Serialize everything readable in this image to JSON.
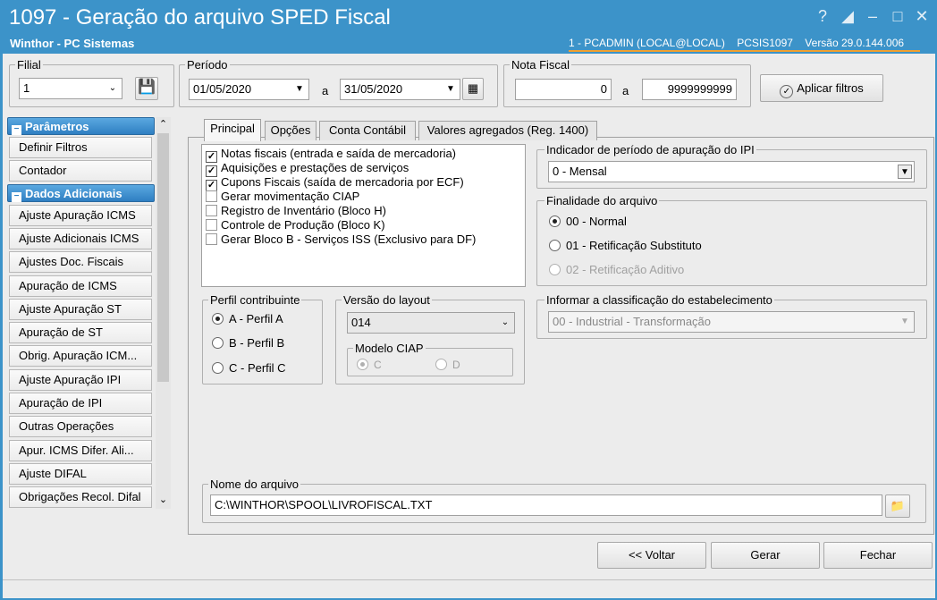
{
  "window": {
    "title": "1097 - Geração do arquivo SPED Fiscal",
    "company": "Winthor - PC Sistemas",
    "user_info": "1 - PCADMIN (LOCAL@LOCAL)",
    "routine": "PCSIS1097",
    "version": "Versão 29.0.144.006"
  },
  "filters": {
    "filial_label": "Filial",
    "filial_value": "1",
    "periodo_label": "Período",
    "periodo_start": "01/05/2020",
    "periodo_sep": "a",
    "periodo_end": "31/05/2020",
    "nota_label": "Nota Fiscal",
    "nota_start": "0",
    "nota_sep": "a",
    "nota_end": "9999999999",
    "apply_label": "Aplicar filtros"
  },
  "sidebar": {
    "section1": "Parâmetros",
    "items1": [
      "Definir Filtros",
      "Contador"
    ],
    "section2": "Dados Adicionais",
    "items2": [
      "Ajuste Apuração ICMS",
      "Ajuste Adicionais ICMS",
      "Ajustes Doc. Fiscais",
      "Apuração de ICMS",
      "Ajuste Apuração ST",
      "Apuração de ST",
      "Obrig. Apuração ICM...",
      "Ajuste Apuração IPI",
      "Apuração de IPI",
      "Outras Operações",
      "Apur. ICMS Difer. Ali...",
      "Ajuste DIFAL",
      "Obrigações Recol. Difal"
    ]
  },
  "tabs": [
    "Principal",
    "Opções",
    "Conta Contábil",
    "Valores agregados (Reg. 1400)"
  ],
  "checklist": [
    {
      "label": "Notas fiscais (entrada e saída de mercadoria)",
      "checked": true
    },
    {
      "label": "Aquisições e prestações de serviços",
      "checked": true
    },
    {
      "label": "Cupons Fiscais (saída de mercadoria por ECF)",
      "checked": true
    },
    {
      "label": "Gerar movimentação CIAP",
      "checked": false
    },
    {
      "label": "Registro de Inventário (Bloco H)",
      "checked": false
    },
    {
      "label": "Controle de Produção (Bloco K)",
      "checked": false
    },
    {
      "label": "Gerar Bloco B - Serviços ISS (Exclusivo para DF)",
      "checked": false
    }
  ],
  "ipi": {
    "label": "Indicador de período de apuração do IPI",
    "value": "0 - Mensal"
  },
  "finalidade": {
    "label": "Finalidade do arquivo",
    "options": [
      "00 - Normal",
      "01 - Retificação Substituto",
      "02 - Retificação Aditivo"
    ],
    "selected": 0
  },
  "perfil": {
    "label": "Perfil contribuinte",
    "options": [
      "A - Perfil A",
      "B - Perfil B",
      "C - Perfil C"
    ],
    "selected": 0
  },
  "layout": {
    "label": "Versão do layout",
    "value": "014",
    "ciap_label": "Modelo CIAP",
    "ciap_c": "C",
    "ciap_d": "D"
  },
  "classificacao": {
    "label": "Informar a classificação do estabelecimento",
    "value": "00 - Industrial - Transformação"
  },
  "arquivo": {
    "label": "Nome do arquivo",
    "value": "C:\\WINTHOR\\SPOOL\\LIVROFISCAL.TXT"
  },
  "buttons": {
    "voltar": "<< Voltar",
    "gerar": "Gerar",
    "fechar": "Fechar"
  }
}
